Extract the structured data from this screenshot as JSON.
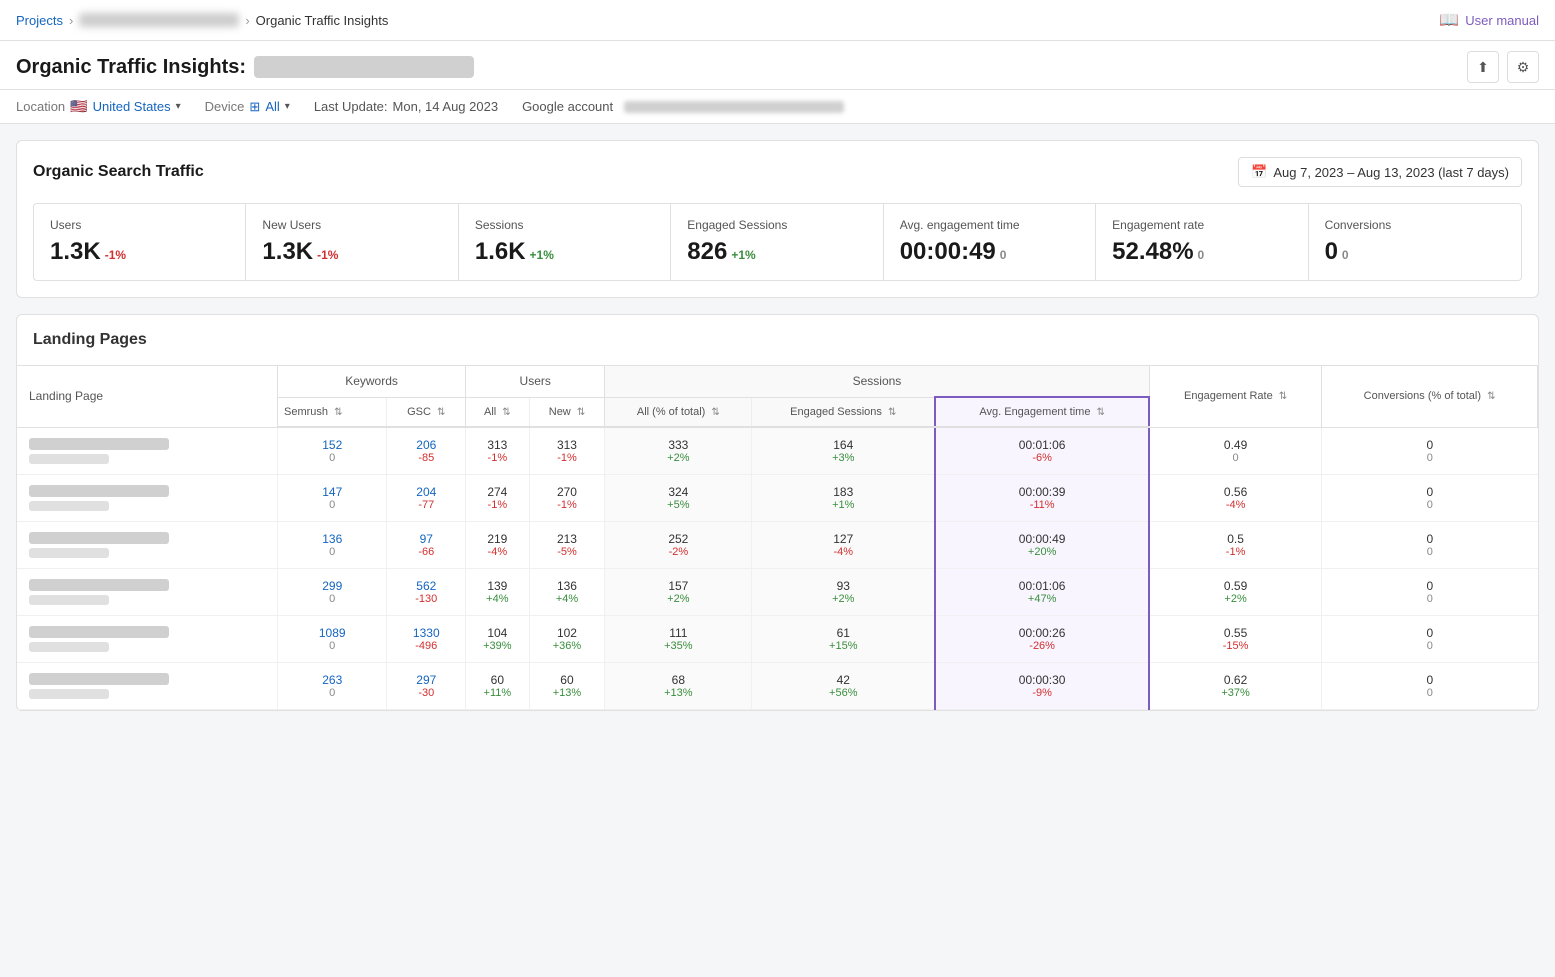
{
  "breadcrumb": {
    "projects_label": "Projects",
    "project_name": "██████████████████",
    "current": "Organic Traffic Insights"
  },
  "user_manual": "User manual",
  "page": {
    "title": "Organic Traffic Insights:",
    "title_blurred": true
  },
  "filters": {
    "location_label": "Location",
    "location_flag": "🇺🇸",
    "location_value": "United States",
    "device_label": "Device",
    "device_icon": "⊞",
    "device_value": "All",
    "last_update_label": "Last Update:",
    "last_update_value": "Mon, 14 Aug 2023",
    "google_account_label": "Google account"
  },
  "organic_search": {
    "title": "Organic Search Traffic",
    "date_range": "Aug 7, 2023 – Aug 13, 2023 (last 7 days)"
  },
  "metrics": [
    {
      "label": "Users",
      "value": "1.3K",
      "change": "-1%",
      "change_type": "negative"
    },
    {
      "label": "New Users",
      "value": "1.3K",
      "change": "-1%",
      "change_type": "negative"
    },
    {
      "label": "Sessions",
      "value": "1.6K",
      "change": "+1%",
      "change_type": "positive"
    },
    {
      "label": "Engaged Sessions",
      "value": "826",
      "change": "+1%",
      "change_type": "positive"
    },
    {
      "label": "Avg. engagement time",
      "value": "00:00:49",
      "change": "0",
      "change_type": "neutral"
    },
    {
      "label": "Engagement rate",
      "value": "52.48%",
      "change": "0",
      "change_type": "neutral"
    },
    {
      "label": "Conversions",
      "value": "0",
      "change": "0",
      "change_type": "neutral"
    }
  ],
  "landing_pages": {
    "title": "Landing Pages",
    "col_groups": [
      {
        "label": "Keywords",
        "span": 2
      },
      {
        "label": "Users",
        "span": 2
      },
      {
        "label": "Sessions",
        "span": 3
      },
      {
        "label": "",
        "span": 1
      },
      {
        "label": "",
        "span": 1
      }
    ],
    "columns": [
      "Landing Page",
      "Semrush",
      "GSC",
      "All",
      "New",
      "All (% of total)",
      "Engaged Sessions",
      "Avg. Engagement time",
      "Engagement Rate",
      "Conversions (% of total)"
    ],
    "rows": [
      {
        "url_blurred": true,
        "semrush": "152",
        "semrush_change": "0",
        "gsc": "206",
        "gsc_change": "-85",
        "users_all": "313",
        "users_all_change": "-1%",
        "users_new": "313",
        "users_new_change": "-1%",
        "sessions_all": "333",
        "sessions_all_change": "+2%",
        "engaged": "164",
        "engaged_change": "+3%",
        "avg_eng": "00:01:06",
        "avg_eng_change": "-6%",
        "eng_rate": "0.49",
        "eng_rate_change": "0",
        "conversions": "0",
        "conversions_change": "0"
      },
      {
        "url_blurred": true,
        "semrush": "147",
        "semrush_change": "0",
        "gsc": "204",
        "gsc_change": "-77",
        "users_all": "274",
        "users_all_change": "-1%",
        "users_new": "270",
        "users_new_change": "-1%",
        "sessions_all": "324",
        "sessions_all_change": "+5%",
        "engaged": "183",
        "engaged_change": "+1%",
        "avg_eng": "00:00:39",
        "avg_eng_change": "-11%",
        "eng_rate": "0.56",
        "eng_rate_change": "-4%",
        "conversions": "0",
        "conversions_change": "0"
      },
      {
        "url_blurred": true,
        "semrush": "136",
        "semrush_change": "0",
        "gsc": "97",
        "gsc_change": "-66",
        "users_all": "219",
        "users_all_change": "-4%",
        "users_new": "213",
        "users_new_change": "-5%",
        "sessions_all": "252",
        "sessions_all_change": "-2%",
        "engaged": "127",
        "engaged_change": "-4%",
        "avg_eng": "00:00:49",
        "avg_eng_change": "+20%",
        "eng_rate": "0.5",
        "eng_rate_change": "-1%",
        "conversions": "0",
        "conversions_change": "0"
      },
      {
        "url_blurred": true,
        "semrush": "299",
        "semrush_change": "0",
        "gsc": "562",
        "gsc_change": "-130",
        "users_all": "139",
        "users_all_change": "+4%",
        "users_new": "136",
        "users_new_change": "+4%",
        "sessions_all": "157",
        "sessions_all_change": "+2%",
        "engaged": "93",
        "engaged_change": "+2%",
        "avg_eng": "00:01:06",
        "avg_eng_change": "+47%",
        "eng_rate": "0.59",
        "eng_rate_change": "+2%",
        "conversions": "0",
        "conversions_change": "0"
      },
      {
        "url_blurred": true,
        "semrush": "1089",
        "semrush_change": "0",
        "gsc": "1330",
        "gsc_change": "-496",
        "users_all": "104",
        "users_all_change": "+39%",
        "users_new": "102",
        "users_new_change": "+36%",
        "sessions_all": "111",
        "sessions_all_change": "+35%",
        "engaged": "61",
        "engaged_change": "+15%",
        "avg_eng": "00:00:26",
        "avg_eng_change": "-26%",
        "eng_rate": "0.55",
        "eng_rate_change": "-15%",
        "conversions": "0",
        "conversions_change": "0"
      },
      {
        "url_blurred": true,
        "semrush": "263",
        "semrush_change": "0",
        "gsc": "297",
        "gsc_change": "-30",
        "users_all": "60",
        "users_all_change": "+11%",
        "users_new": "60",
        "users_new_change": "+13%",
        "sessions_all": "68",
        "sessions_all_change": "+13%",
        "engaged": "42",
        "engaged_change": "+56%",
        "avg_eng": "00:00:30",
        "avg_eng_change": "-9%",
        "eng_rate": "0.62",
        "eng_rate_change": "+37%",
        "conversions": "0",
        "conversions_change": "0"
      }
    ]
  }
}
